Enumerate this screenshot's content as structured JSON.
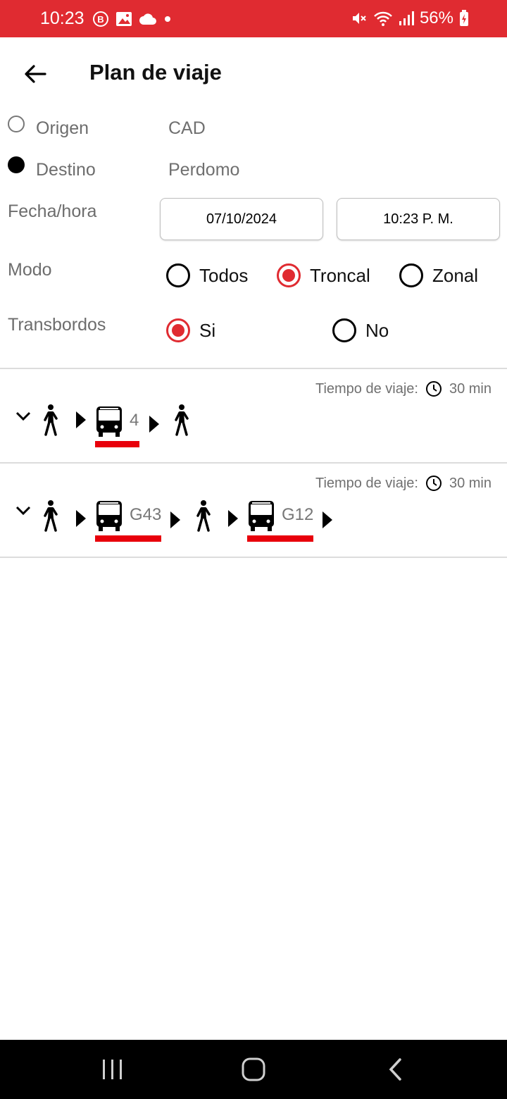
{
  "status_bar": {
    "time": "10:23",
    "left_icons": [
      "b-circle-icon",
      "image-icon",
      "cloud-icon",
      "dot-icon"
    ],
    "right_icons": [
      "mute-icon",
      "wifi-icon",
      "signal-icon",
      "battery-charging-icon"
    ],
    "battery": "56%",
    "color": "#e02b31"
  },
  "header": {
    "title": "Plan de viaje",
    "back_icon": "arrow-left-icon"
  },
  "trip": {
    "origin_label": "Origen",
    "origin_value": "CAD",
    "destination_label": "Destino",
    "destination_value": "Perdomo",
    "datetime_label": "Fecha/hora",
    "date": "07/10/2024",
    "time": "10:23 P. M.",
    "mode_label": "Modo",
    "mode_options": [
      "Todos",
      "Troncal",
      "Zonal"
    ],
    "mode_selected": "Troncal",
    "transfers_label": "Transbordos",
    "transfers_options": [
      "Si",
      "No"
    ],
    "transfers_selected": "Si"
  },
  "routes": [
    {
      "travel_time_label": "Tiempo de viaje:",
      "travel_time": "30 min",
      "steps": [
        "walk",
        "arrow",
        "bus:4",
        "arrow",
        "walk"
      ]
    },
    {
      "travel_time_label": "Tiempo de viaje:",
      "travel_time": "30 min",
      "steps": [
        "walk",
        "arrow",
        "bus:G43",
        "arrow",
        "walk",
        "arrow",
        "bus:G12",
        "arrow"
      ]
    }
  ],
  "route_line_color": "#e8000b",
  "accent_color": "#e02b31",
  "nav_bar": [
    "recents-icon",
    "home-icon",
    "back-icon"
  ]
}
